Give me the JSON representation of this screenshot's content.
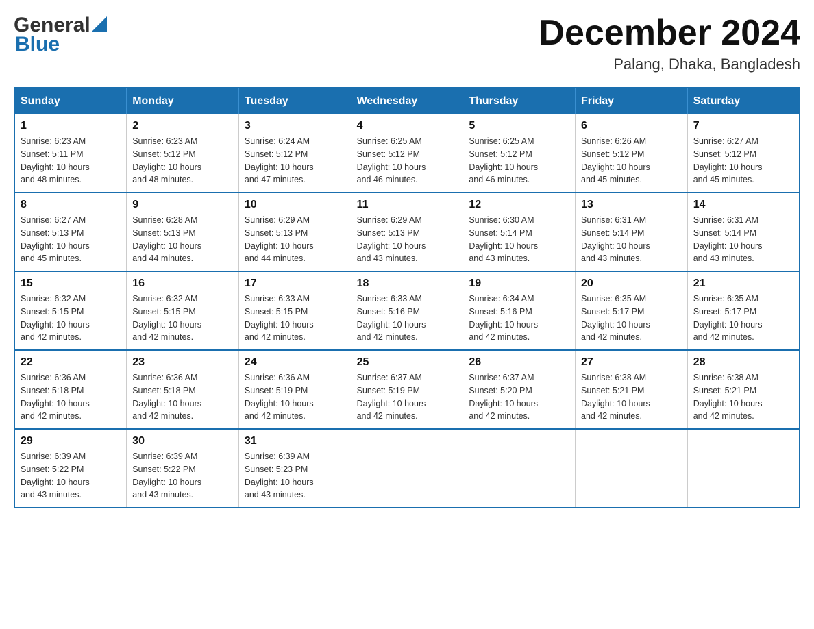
{
  "header": {
    "logo_general": "General",
    "logo_blue": "Blue",
    "month_title": "December 2024",
    "location": "Palang, Dhaka, Bangladesh"
  },
  "calendar": {
    "days_of_week": [
      "Sunday",
      "Monday",
      "Tuesday",
      "Wednesday",
      "Thursday",
      "Friday",
      "Saturday"
    ],
    "weeks": [
      [
        {
          "day": "1",
          "sunrise": "6:23 AM",
          "sunset": "5:11 PM",
          "daylight": "10 hours and 48 minutes."
        },
        {
          "day": "2",
          "sunrise": "6:23 AM",
          "sunset": "5:12 PM",
          "daylight": "10 hours and 48 minutes."
        },
        {
          "day": "3",
          "sunrise": "6:24 AM",
          "sunset": "5:12 PM",
          "daylight": "10 hours and 47 minutes."
        },
        {
          "day": "4",
          "sunrise": "6:25 AM",
          "sunset": "5:12 PM",
          "daylight": "10 hours and 46 minutes."
        },
        {
          "day": "5",
          "sunrise": "6:25 AM",
          "sunset": "5:12 PM",
          "daylight": "10 hours and 46 minutes."
        },
        {
          "day": "6",
          "sunrise": "6:26 AM",
          "sunset": "5:12 PM",
          "daylight": "10 hours and 45 minutes."
        },
        {
          "day": "7",
          "sunrise": "6:27 AM",
          "sunset": "5:12 PM",
          "daylight": "10 hours and 45 minutes."
        }
      ],
      [
        {
          "day": "8",
          "sunrise": "6:27 AM",
          "sunset": "5:13 PM",
          "daylight": "10 hours and 45 minutes."
        },
        {
          "day": "9",
          "sunrise": "6:28 AM",
          "sunset": "5:13 PM",
          "daylight": "10 hours and 44 minutes."
        },
        {
          "day": "10",
          "sunrise": "6:29 AM",
          "sunset": "5:13 PM",
          "daylight": "10 hours and 44 minutes."
        },
        {
          "day": "11",
          "sunrise": "6:29 AM",
          "sunset": "5:13 PM",
          "daylight": "10 hours and 43 minutes."
        },
        {
          "day": "12",
          "sunrise": "6:30 AM",
          "sunset": "5:14 PM",
          "daylight": "10 hours and 43 minutes."
        },
        {
          "day": "13",
          "sunrise": "6:31 AM",
          "sunset": "5:14 PM",
          "daylight": "10 hours and 43 minutes."
        },
        {
          "day": "14",
          "sunrise": "6:31 AM",
          "sunset": "5:14 PM",
          "daylight": "10 hours and 43 minutes."
        }
      ],
      [
        {
          "day": "15",
          "sunrise": "6:32 AM",
          "sunset": "5:15 PM",
          "daylight": "10 hours and 42 minutes."
        },
        {
          "day": "16",
          "sunrise": "6:32 AM",
          "sunset": "5:15 PM",
          "daylight": "10 hours and 42 minutes."
        },
        {
          "day": "17",
          "sunrise": "6:33 AM",
          "sunset": "5:15 PM",
          "daylight": "10 hours and 42 minutes."
        },
        {
          "day": "18",
          "sunrise": "6:33 AM",
          "sunset": "5:16 PM",
          "daylight": "10 hours and 42 minutes."
        },
        {
          "day": "19",
          "sunrise": "6:34 AM",
          "sunset": "5:16 PM",
          "daylight": "10 hours and 42 minutes."
        },
        {
          "day": "20",
          "sunrise": "6:35 AM",
          "sunset": "5:17 PM",
          "daylight": "10 hours and 42 minutes."
        },
        {
          "day": "21",
          "sunrise": "6:35 AM",
          "sunset": "5:17 PM",
          "daylight": "10 hours and 42 minutes."
        }
      ],
      [
        {
          "day": "22",
          "sunrise": "6:36 AM",
          "sunset": "5:18 PM",
          "daylight": "10 hours and 42 minutes."
        },
        {
          "day": "23",
          "sunrise": "6:36 AM",
          "sunset": "5:18 PM",
          "daylight": "10 hours and 42 minutes."
        },
        {
          "day": "24",
          "sunrise": "6:36 AM",
          "sunset": "5:19 PM",
          "daylight": "10 hours and 42 minutes."
        },
        {
          "day": "25",
          "sunrise": "6:37 AM",
          "sunset": "5:19 PM",
          "daylight": "10 hours and 42 minutes."
        },
        {
          "day": "26",
          "sunrise": "6:37 AM",
          "sunset": "5:20 PM",
          "daylight": "10 hours and 42 minutes."
        },
        {
          "day": "27",
          "sunrise": "6:38 AM",
          "sunset": "5:21 PM",
          "daylight": "10 hours and 42 minutes."
        },
        {
          "day": "28",
          "sunrise": "6:38 AM",
          "sunset": "5:21 PM",
          "daylight": "10 hours and 42 minutes."
        }
      ],
      [
        {
          "day": "29",
          "sunrise": "6:39 AM",
          "sunset": "5:22 PM",
          "daylight": "10 hours and 43 minutes."
        },
        {
          "day": "30",
          "sunrise": "6:39 AM",
          "sunset": "5:22 PM",
          "daylight": "10 hours and 43 minutes."
        },
        {
          "day": "31",
          "sunrise": "6:39 AM",
          "sunset": "5:23 PM",
          "daylight": "10 hours and 43 minutes."
        },
        null,
        null,
        null,
        null
      ]
    ],
    "labels": {
      "sunrise": "Sunrise:",
      "sunset": "Sunset:",
      "daylight": "Daylight:"
    }
  }
}
